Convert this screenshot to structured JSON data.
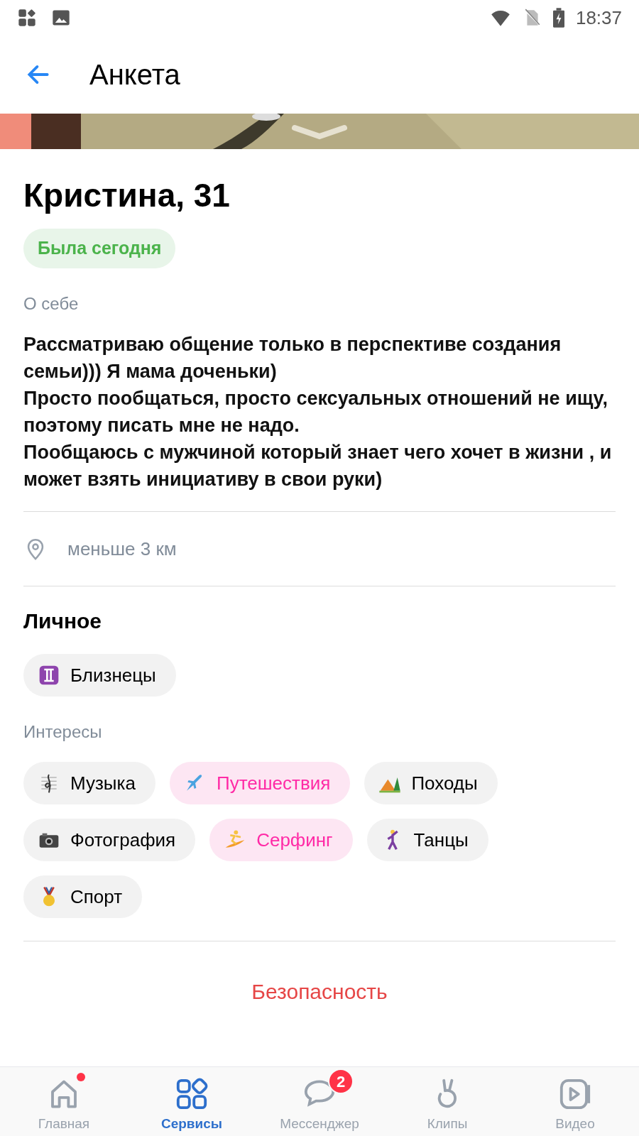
{
  "status_bar": {
    "time": "18:37"
  },
  "header": {
    "title": "Анкета"
  },
  "profile": {
    "name": "Кристина, 31",
    "presence": "Была сегодня"
  },
  "about": {
    "label": "О себе",
    "text": "Рассматриваю общение только в перспективе создания семьи))) Я мама доченьки)\nПросто пообщаться, просто сексуальных отношений не ищу, поэтому писать мне не надо.\nПообщаюсь с мужчиной который знает чего хочет в жизни , и может взять инициативу в свои руки)"
  },
  "location": {
    "text": "меньше 3 км"
  },
  "personal": {
    "title": "Личное",
    "chips": [
      {
        "label": "Близнецы",
        "common": false
      }
    ]
  },
  "interests": {
    "label": "Интересы",
    "chips": [
      {
        "label": "Музыка",
        "common": false
      },
      {
        "label": "Путешествия",
        "common": true
      },
      {
        "label": "Походы",
        "common": false
      },
      {
        "label": "Фотография",
        "common": false
      },
      {
        "label": "Серфинг",
        "common": true
      },
      {
        "label": "Танцы",
        "common": false
      },
      {
        "label": "Спорт",
        "common": false
      }
    ]
  },
  "safety_link": "Безопасность",
  "nav": [
    {
      "label": "Главная",
      "selected": false,
      "dot": true
    },
    {
      "label": "Сервисы",
      "selected": true,
      "dot": false
    },
    {
      "label": "Мессенджер",
      "selected": false,
      "dot": false,
      "badge": "2"
    },
    {
      "label": "Клипы",
      "selected": false,
      "dot": false
    },
    {
      "label": "Видео",
      "selected": false,
      "dot": false
    }
  ]
}
